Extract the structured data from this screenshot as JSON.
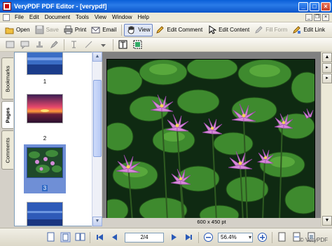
{
  "window": {
    "title": "VeryPDF PDF Editor - [verypdf]"
  },
  "menu": [
    "File",
    "Edit",
    "Document",
    "Tools",
    "View",
    "Window",
    "Help"
  ],
  "toolbar": {
    "open": "Open",
    "save": "Save",
    "print": "Print",
    "email": "Email",
    "view": "View",
    "edit_comment": "Edit Comment",
    "edit_content": "Edit Content",
    "fill_form": "Fill Form",
    "edit_link": "Edit Link"
  },
  "side_tabs": [
    "Bookmarks",
    "Pages",
    "Comments"
  ],
  "thumbnails": [
    {
      "label": "1"
    },
    {
      "label": "2"
    },
    {
      "label": "3"
    }
  ],
  "document": {
    "page_size": "600 x 450 pt"
  },
  "navigation": {
    "page": "2/4",
    "zoom": "56.4%"
  },
  "watermark": "© VeryPDF",
  "colors": {
    "titlebar": "#0a5fd8",
    "selection": "#316ac5",
    "workspace": "#808080"
  }
}
